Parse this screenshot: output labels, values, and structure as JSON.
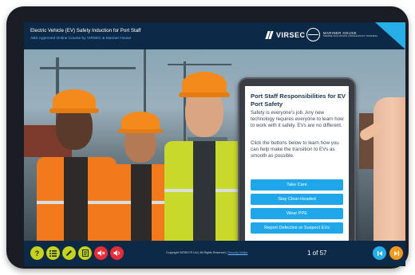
{
  "header": {
    "course_title": "Electric Vehicle (EV) Safety Induction for Port Staff",
    "course_subtitle": "ABS Approved Online Course by VIRSEC & Mariner House",
    "brand_name": "VIRSEC",
    "partner_name": "MARINER HOUSE",
    "partner_tagline": "MARINE SOLUTIONS  CONSULTANCY  TRAINING"
  },
  "phone": {
    "title": "Port Staff Responsibilities for EV Port Safety",
    "paragraph_1": "Safety is everyone's job. Any new technology requires everyone to learn how to work with it safely. EVs are no different.",
    "paragraph_2": "Click the buttons below to learn how you can help make the transition to EVs as smooth as possible.",
    "buttons": [
      {
        "label": "Take Care"
      },
      {
        "label": "Stay Clear-Headed"
      },
      {
        "label": "Wear PPE"
      },
      {
        "label": "Report Defective or Suspect EVs"
      }
    ]
  },
  "footer": {
    "copyright_text": "Copyright VIRSEC® Ltd | All Rights Reserved  |",
    "security_link": "Security Notice",
    "page_counter": "1 of 57",
    "controls": [
      {
        "name": "help",
        "icon": "question-icon",
        "glyph": "?",
        "color": "#c7d21b"
      },
      {
        "name": "menu",
        "icon": "list-icon",
        "color": "#c7d21b"
      },
      {
        "name": "notes",
        "icon": "pencil-icon",
        "color": "#c7d21b"
      },
      {
        "name": "resources",
        "icon": "document-icon",
        "color": "#c7d21b"
      },
      {
        "name": "audio-off",
        "icon": "speaker-muted-icon",
        "color": "#e52e3a"
      },
      {
        "name": "volume",
        "icon": "speaker-icon",
        "color": "#e52e3a"
      }
    ],
    "nav_prev_color": "#27aee8",
    "nav_next_color": "#f39a1e"
  },
  "colors": {
    "bar_background": "#0c2a47",
    "accent_blue": "#1fa7ea",
    "device_frame": "#1b1d24"
  }
}
